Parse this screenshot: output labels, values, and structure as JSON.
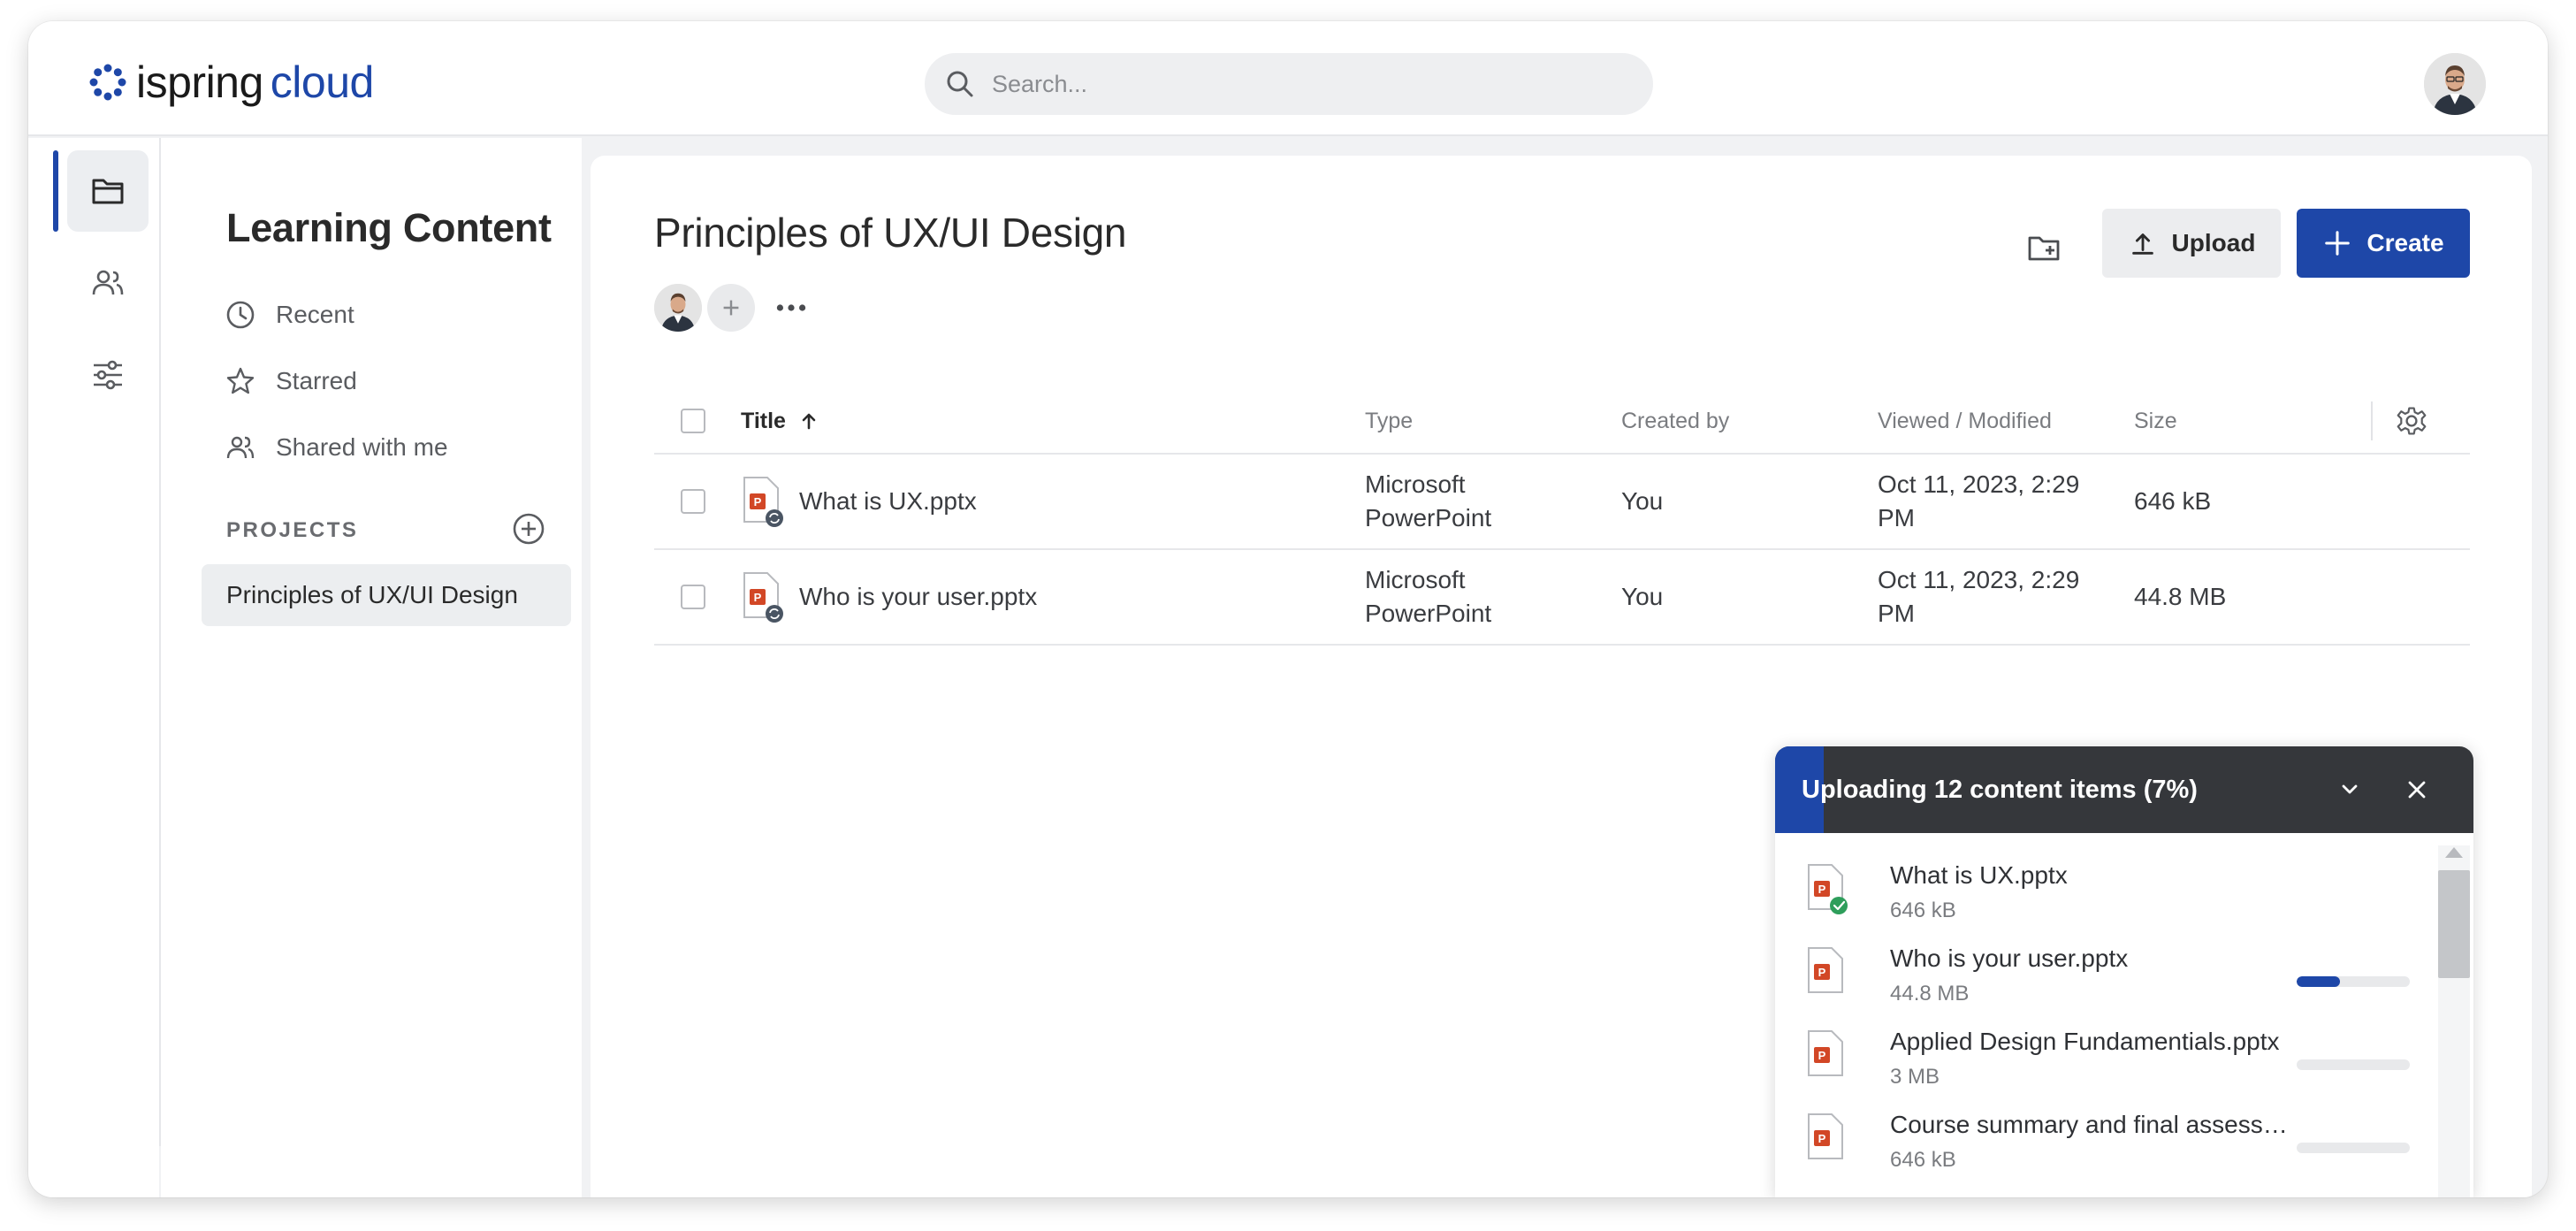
{
  "logo": {
    "part1": "ispring",
    "part2": "cloud"
  },
  "search": {
    "placeholder": "Search..."
  },
  "sidebar": {
    "title": "Learning Content",
    "links": [
      {
        "label": "Recent",
        "icon": "clock-icon"
      },
      {
        "label": "Starred",
        "icon": "star-icon"
      },
      {
        "label": "Shared with me",
        "icon": "people-icon"
      }
    ],
    "projects_label": "PROJECTS",
    "projects": [
      {
        "label": "Principles of UX/UI Design"
      }
    ]
  },
  "main": {
    "title": "Principles of UX/UI Design",
    "upload_label": "Upload",
    "create_label": "Create"
  },
  "table": {
    "columns": {
      "title": "Title",
      "type": "Type",
      "created_by": "Created by",
      "viewed": "Viewed / Modified",
      "size": "Size"
    },
    "rows": [
      {
        "title": "What is UX.pptx",
        "type_line1": "Microsoft",
        "type_line2": "PowerPoint",
        "created_by": "You",
        "viewed_line1": "Oct 11, 2023, 2:29",
        "viewed_line2": "PM",
        "size": "646 kB"
      },
      {
        "title": "Who is your user.pptx",
        "type_line1": "Microsoft",
        "type_line2": "PowerPoint",
        "created_by": "You",
        "viewed_line1": "Oct 11, 2023, 2:29",
        "viewed_line2": "PM",
        "size": "44.8 MB"
      }
    ]
  },
  "upload_panel": {
    "title": "Uploading 12 content items (7%)",
    "progress_percent": 7,
    "items": [
      {
        "name": "What is UX.pptx",
        "size": "646 kB",
        "status": "done",
        "progress": 1.0
      },
      {
        "name": "Who is your user.pptx",
        "size": "44.8 MB",
        "status": "uploading",
        "progress": 0.38
      },
      {
        "name": "Applied Design Fundamentials.pptx",
        "size": "3 MB",
        "status": "queued",
        "progress": 0
      },
      {
        "name": "Course summary and final assessment.pptx",
        "size": "646 kB",
        "status": "queued",
        "progress": 0
      }
    ]
  },
  "colors": {
    "accent": "#1e47a8",
    "panel_header": "#35373b",
    "success": "#2e9e5b",
    "ppt": "#d24726"
  }
}
